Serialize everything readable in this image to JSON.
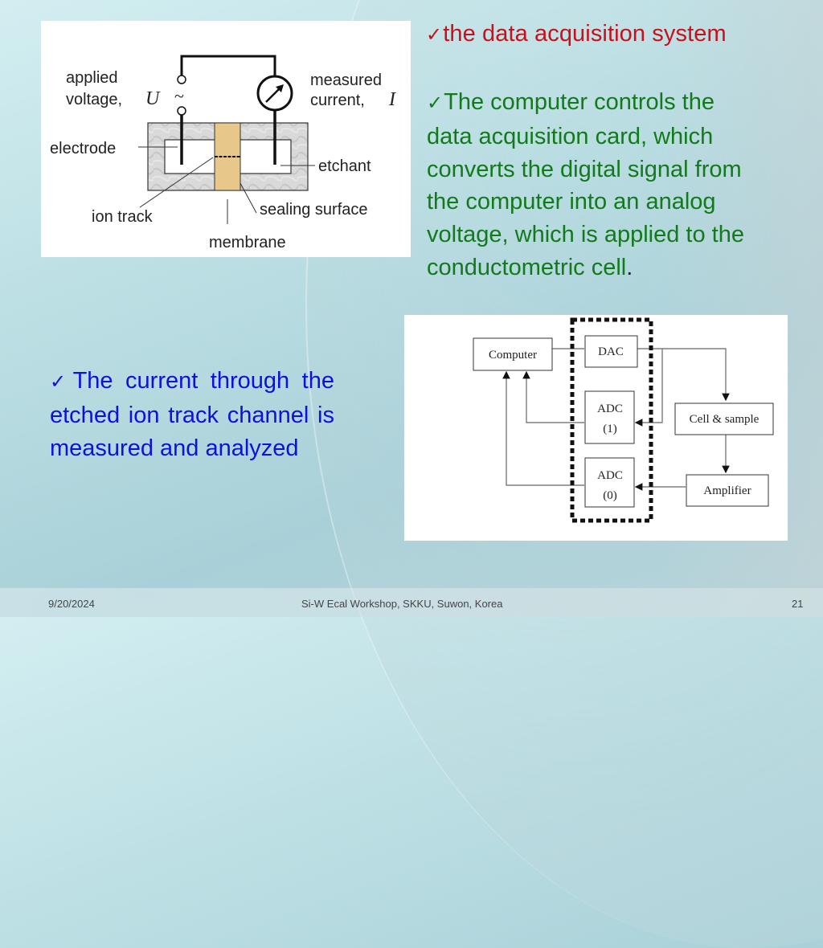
{
  "slide": {
    "heading": {
      "check": "✓",
      "text": "the data acquisition system",
      "color": "#c8101b"
    },
    "right_paragraph": {
      "check": "✓",
      "lines": [
        "The computer controls the",
        "data acquisition card, which",
        "converts the digital signal from",
        "the computer into an analog",
        "voltage, which is applied to the",
        "conductometric cell"
      ],
      "end_punct": ".",
      "color": "#127a1a"
    },
    "left_paragraph": {
      "check": "✓",
      "text": "The current through the etched ion track channel is measured and analyzed",
      "color": "#1010dd"
    }
  },
  "figure_cell": {
    "labels": {
      "applied": "applied",
      "voltage": "voltage,",
      "U": "U",
      "tilde": "~",
      "measured": "measured",
      "current": "current,",
      "I": "I",
      "electrode": "electrode",
      "etchant": "etchant",
      "ion_track": "ion track",
      "sealing_surface": "sealing surface",
      "membrane": "membrane"
    }
  },
  "figure_daq": {
    "blocks": {
      "computer": "Computer",
      "dac": "DAC",
      "adc1_a": "ADC",
      "adc1_b": "(1)",
      "adc0_a": "ADC",
      "adc0_b": "(0)",
      "cell": "Cell & sample",
      "amp": "Amplifier"
    }
  },
  "footer": {
    "date": "9/20/2024",
    "title": "Si-W Ecal Workshop, SKKU, Suwon, Korea",
    "page": "21"
  }
}
